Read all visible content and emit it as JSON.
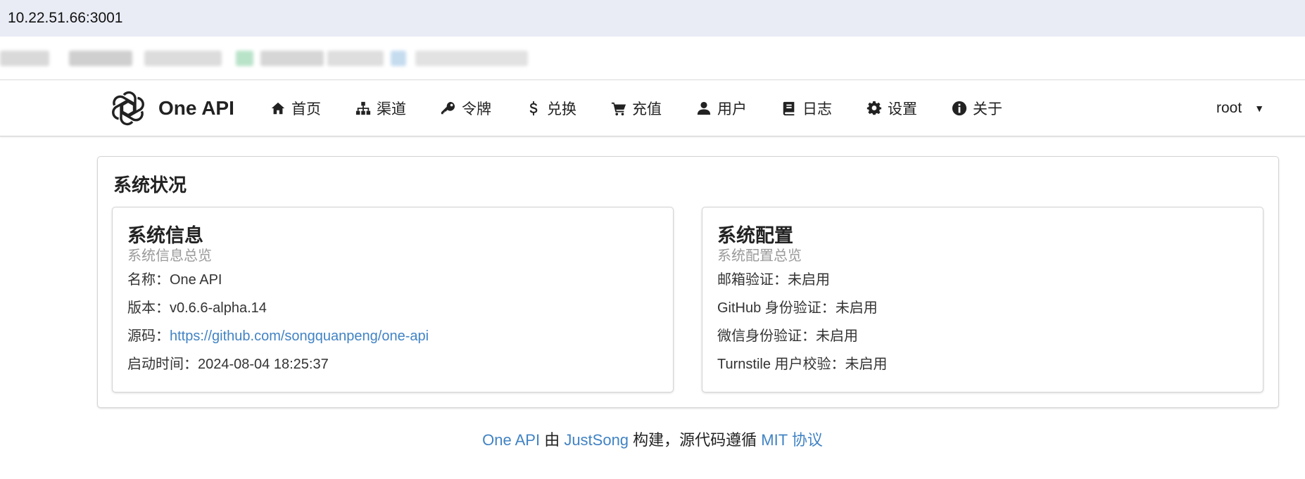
{
  "browser": {
    "address": "10.22.51.66:3001"
  },
  "brand": {
    "name": "One API"
  },
  "nav": [
    {
      "label": "首页",
      "icon": "home-icon"
    },
    {
      "label": "渠道",
      "icon": "sitemap-icon"
    },
    {
      "label": "令牌",
      "icon": "key-icon"
    },
    {
      "label": "兑换",
      "icon": "dollar-icon"
    },
    {
      "label": "充值",
      "icon": "cart-icon"
    },
    {
      "label": "用户",
      "icon": "user-icon"
    },
    {
      "label": "日志",
      "icon": "book-icon"
    },
    {
      "label": "设置",
      "icon": "gear-icon"
    },
    {
      "label": "关于",
      "icon": "info-icon"
    }
  ],
  "user": {
    "name": "root"
  },
  "status": {
    "title": "系统状况",
    "info": {
      "header": "系统信息",
      "meta": "系统信息总览",
      "name_label": "名称：",
      "name_value": "One API",
      "version_label": "版本：",
      "version_value": "v0.6.6-alpha.14",
      "source_label": "源码：",
      "source_value": "https://github.com/songquanpeng/one-api",
      "start_label": "启动时间：",
      "start_value": "2024-08-04 18:25:37"
    },
    "config": {
      "header": "系统配置",
      "meta": "系统配置总览",
      "email_label": "邮箱验证：",
      "email_value": "未启用",
      "github_label": "GitHub 身份验证：",
      "github_value": "未启用",
      "wechat_label": "微信身份验证：",
      "wechat_value": "未启用",
      "turnstile_label": "Turnstile 用户校验：",
      "turnstile_value": "未启用"
    }
  },
  "footer": {
    "project": "One API",
    "by": " 由 ",
    "author": "JustSong",
    "middle": " 构建，源代码遵循 ",
    "license": "MIT 协议"
  },
  "colors": {
    "link": "#4183c4",
    "muted": "#9a9a9a",
    "address_bar": "#e9ecf5"
  }
}
